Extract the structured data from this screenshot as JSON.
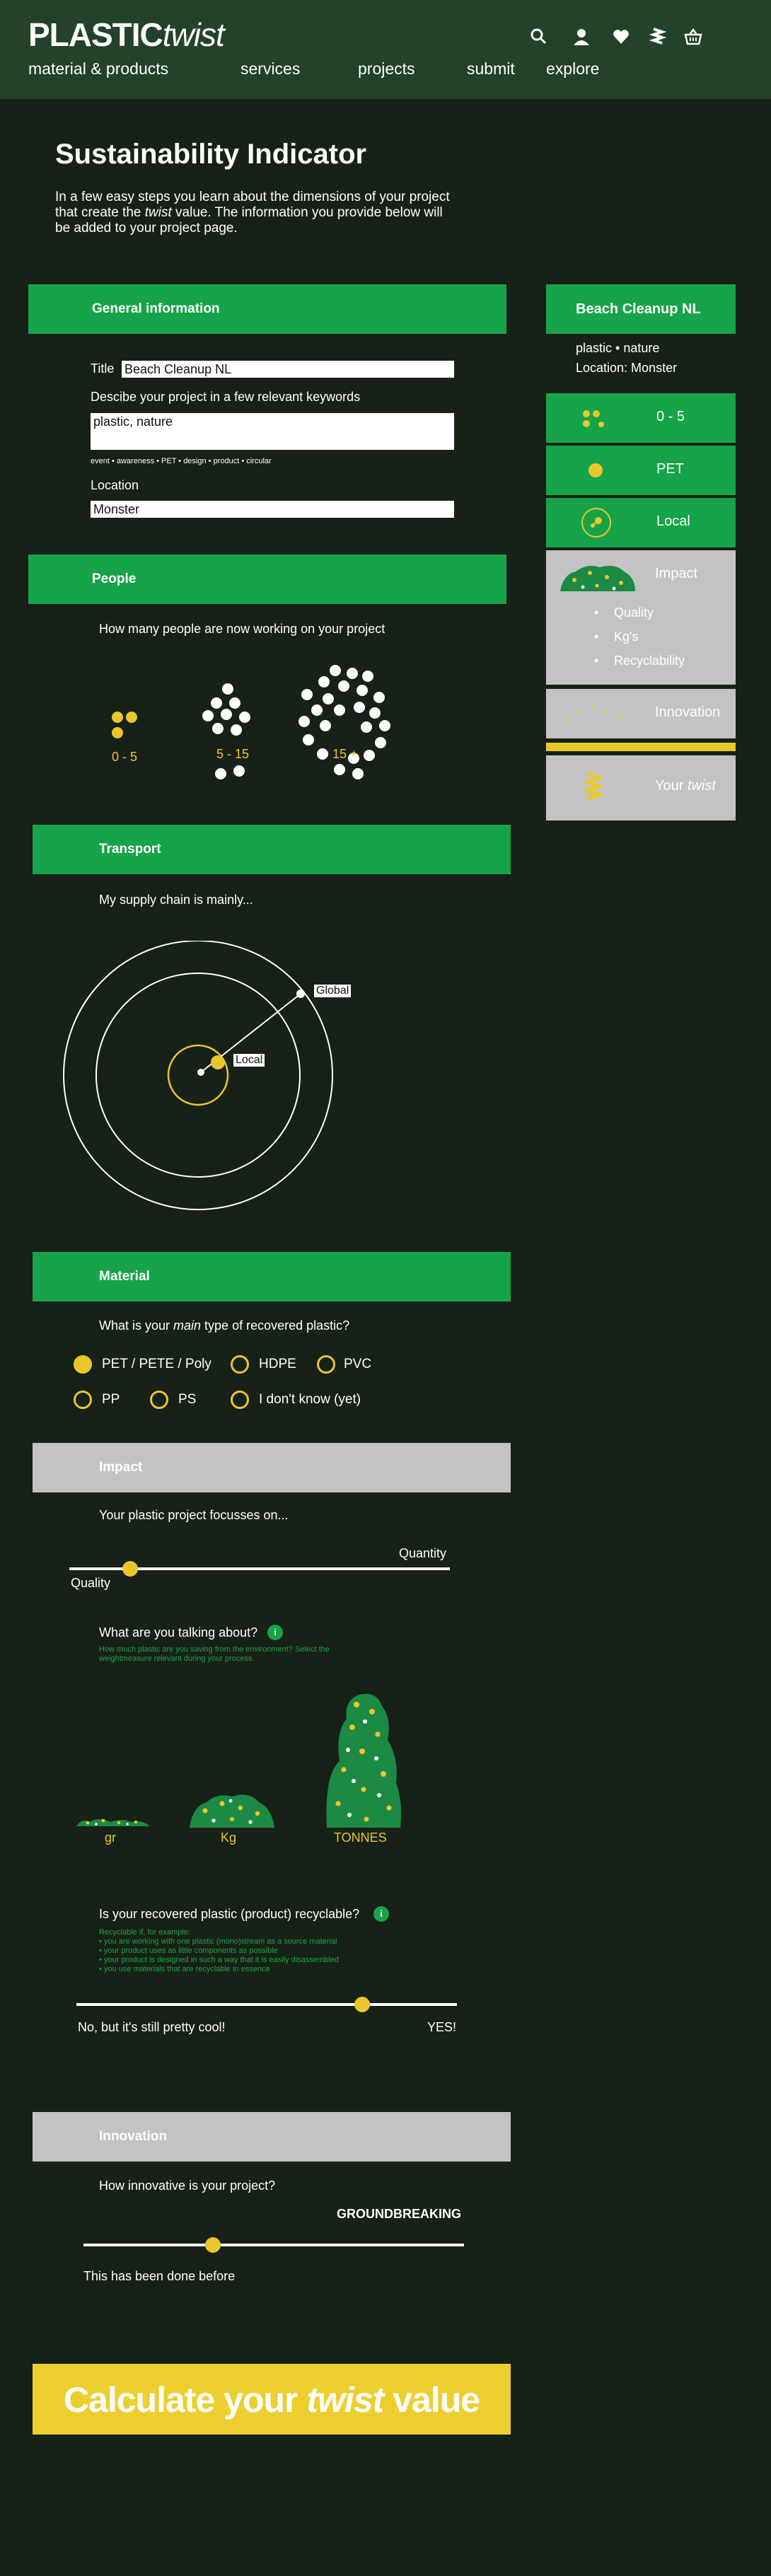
{
  "header": {
    "logo_bold": "PLASTIC",
    "logo_italic": "twist",
    "nav": [
      "material & products",
      "services",
      "projects",
      "submit",
      "explore"
    ],
    "icons": [
      "search-icon",
      "user-icon",
      "heart-icon",
      "twist-icon",
      "basket-icon"
    ]
  },
  "intro": {
    "title": "Sustainability Indicator",
    "text_before": "In a few easy steps you learn about the dimensions of your project that create the ",
    "text_em": "twist",
    "text_after": " value. The information you provide below will be added to your project page."
  },
  "general": {
    "heading": "General information",
    "title_label": "Title",
    "title_value": "Beach Cleanup NL",
    "keywords_label": "Descibe your project in a few relevant keywords",
    "keywords_value": "plastic, nature",
    "suggestions": "event • awareness • PET • design • product • circular",
    "location_label": "Location",
    "location_value": "Monster"
  },
  "people": {
    "heading": "People",
    "question": "How many people are now working on your project",
    "options": [
      "0 - 5",
      "5 - 15",
      "15 +"
    ],
    "selected": 0
  },
  "transport": {
    "heading": "Transport",
    "question": "My supply chain is mainly...",
    "global_label": "Global",
    "local_label": "Local",
    "selected": "local"
  },
  "material": {
    "heading": "Material",
    "question_before": "What is your ",
    "question_em": "main",
    "question_after": " type of recovered plastic?",
    "options": [
      "PET / PETE / Poly",
      "HDPE",
      "PVC",
      "PP",
      "PS",
      "I don't know (yet)"
    ],
    "selected": 0
  },
  "impact": {
    "heading": "Impact",
    "focus_question": "Your plastic project focusses on...",
    "focus_left": "Quality",
    "focus_right": "Quantity",
    "focus_value": 0.16,
    "amount_question": "What are you talking about?",
    "amount_hint": "How much plastic are you saving from the environment? Select the weightmeasure relevant during your process.",
    "amount_options": [
      "gr",
      "Kg",
      "TONNES"
    ],
    "recycle_question": "Is your recovered plastic (product) recyclable?",
    "recycle_hint": [
      "Recyclable if, for example:",
      "• you are working with one plastic (mono)stream as a source material",
      "• your product uses as little components as possible",
      "• your product is designed in such a way that it is easily disassembled",
      "• you use materials that are recyclable in essence"
    ],
    "recycle_left": "No, but it's still pretty cool!",
    "recycle_right": "YES!",
    "recycle_value": 0.75,
    "info_icon": "info-icon"
  },
  "innovation": {
    "heading": "Innovation",
    "question": "How innovative is your project?",
    "right_label": "GROUNDBREAKING",
    "left_label": "This has been done before",
    "value": 0.34
  },
  "cta": {
    "text_before": "Calculate your ",
    "text_em": "twist",
    "text_after": " value"
  },
  "sidebar": {
    "title": "Beach Cleanup NL",
    "keywords": "plastic • nature",
    "location": "Location: Monster",
    "people": "0 - 5",
    "material": "PET",
    "transport": "Local",
    "impact_label": "Impact",
    "impact_items": [
      "Quality",
      "Kg's",
      "Recyclability"
    ],
    "innovation_label": "Innovation",
    "twist_before": "Your ",
    "twist_em": "twist"
  },
  "colors": {
    "background": "#172117",
    "header": "#24412a",
    "green": "#17a34a",
    "grey": "#c3c3c3",
    "yellow": "#e9c72c"
  }
}
